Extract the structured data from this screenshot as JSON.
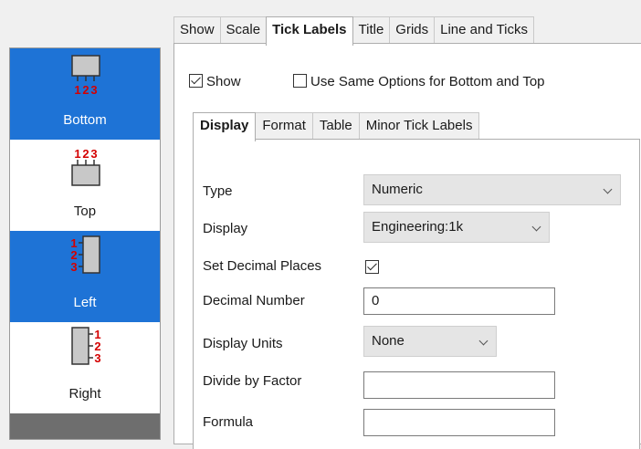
{
  "main_tabs": [
    {
      "label": "Show"
    },
    {
      "label": "Scale"
    },
    {
      "label": "Tick Labels",
      "active": true
    },
    {
      "label": "Title"
    },
    {
      "label": "Grids"
    },
    {
      "label": "Line and Ticks"
    }
  ],
  "axes": [
    {
      "label": "Bottom",
      "selected": true,
      "icon": "bottom-axis-icon"
    },
    {
      "label": "Top",
      "selected": false,
      "icon": "top-axis-icon"
    },
    {
      "label": "Left",
      "selected": true,
      "icon": "left-axis-icon"
    },
    {
      "label": "Right",
      "selected": false,
      "icon": "right-axis-icon"
    }
  ],
  "axis_icon_digits": [
    "1",
    "2",
    "3"
  ],
  "options": {
    "show_label": "Show",
    "show_checked": true,
    "same_options_label": "Use Same Options for Bottom and Top",
    "same_options_checked": false
  },
  "sub_tabs": [
    {
      "label": "Display",
      "active": true
    },
    {
      "label": "Format"
    },
    {
      "label": "Table"
    },
    {
      "label": "Minor Tick Labels"
    }
  ],
  "form": {
    "type_label": "Type",
    "type_value": "Numeric",
    "display_label": "Display",
    "display_value": "Engineering:1k",
    "set_decimal_label": "Set Decimal Places",
    "set_decimal_checked": true,
    "decimal_number_label": "Decimal Number",
    "decimal_number_value": "0",
    "display_units_label": "Display Units",
    "display_units_value": "None",
    "divide_factor_label": "Divide by Factor",
    "divide_factor_value": "",
    "formula_label": "Formula",
    "formula_value": ""
  },
  "colors": {
    "selection": "#1e73d6",
    "digits": "#d40000"
  }
}
